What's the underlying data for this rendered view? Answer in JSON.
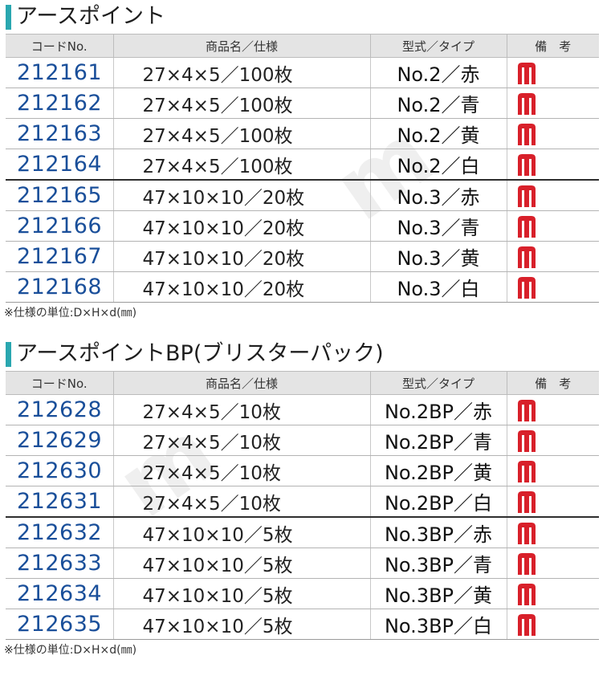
{
  "sections": [
    {
      "title": "アースポイント",
      "headers": [
        "コードNo.",
        "商品名／仕様",
        "型式／タイプ",
        "備　考"
      ],
      "rows": [
        {
          "code": "212161",
          "spec": "27×4×5／100枚",
          "type": "No.2／赤"
        },
        {
          "code": "212162",
          "spec": "27×4×5／100枚",
          "type": "No.2／青"
        },
        {
          "code": "212163",
          "spec": "27×4×5／100枚",
          "type": "No.2／黄"
        },
        {
          "code": "212164",
          "spec": "27×4×5／100枚",
          "type": "No.2／白"
        },
        {
          "code": "212165",
          "spec": "47×10×10／20枚",
          "type": "No.3／赤"
        },
        {
          "code": "212166",
          "spec": "47×10×10／20枚",
          "type": "No.3／青"
        },
        {
          "code": "212167",
          "spec": "47×10×10／20枚",
          "type": "No.3／黄"
        },
        {
          "code": "212168",
          "spec": "47×10×10／20枚",
          "type": "No.3／白"
        }
      ],
      "footnote": "※仕様の単位:D×H×d(㎜)"
    },
    {
      "title": "アースポイントBP(ブリスターパック)",
      "headers": [
        "コードNo.",
        "商品名／仕様",
        "型式／タイプ",
        "備　考"
      ],
      "rows": [
        {
          "code": "212628",
          "spec": "27×4×5／10枚",
          "type": "No.2BP／赤"
        },
        {
          "code": "212629",
          "spec": "27×4×5／10枚",
          "type": "No.2BP／青"
        },
        {
          "code": "212630",
          "spec": "27×4×5／10枚",
          "type": "No.2BP／黄"
        },
        {
          "code": "212631",
          "spec": "27×4×5／10枚",
          "type": "No.2BP／白"
        },
        {
          "code": "212632",
          "spec": "47×10×10／5枚",
          "type": "No.3BP／赤"
        },
        {
          "code": "212633",
          "spec": "47×10×10／5枚",
          "type": "No.3BP／青"
        },
        {
          "code": "212634",
          "spec": "47×10×10／5枚",
          "type": "No.3BP／黄"
        },
        {
          "code": "212635",
          "spec": "47×10×10／5枚",
          "type": "No.3BP／白"
        }
      ],
      "footnote": "※仕様の単位:D×H×d(㎜)"
    }
  ],
  "note_icon": "m-icon",
  "colors": {
    "title_bar": "#2aa7b0",
    "code_text": "#1a4f9a",
    "header_bg": "#e4e4e4",
    "icon_red": "#d8202a"
  }
}
